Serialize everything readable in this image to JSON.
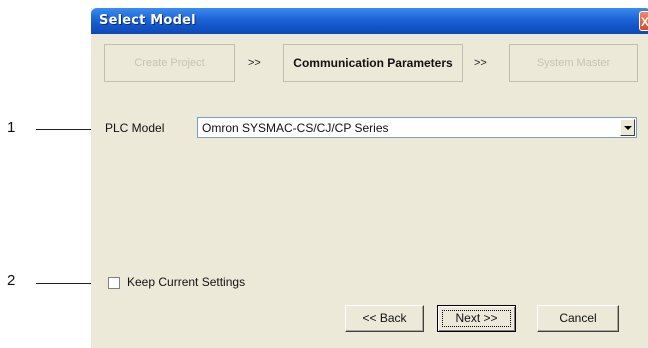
{
  "callouts": [
    {
      "number": "1",
      "target": "PLC Model"
    },
    {
      "number": "2",
      "target": "Keep Current Settings"
    }
  ],
  "dialog": {
    "title": "Select Model",
    "close_glyph": "X"
  },
  "steps": {
    "items": [
      {
        "label": "Create Project",
        "state": "disabled"
      },
      {
        "label": "Communication Parameters",
        "state": "active"
      },
      {
        "label": "System Master",
        "state": "disabled"
      }
    ],
    "separator": ">>"
  },
  "plc_model": {
    "label": "PLC Model",
    "selected": "Omron SYSMAC-CS/CJ/CP Series"
  },
  "keep_settings": {
    "label": "Keep Current Settings",
    "checked": false
  },
  "buttons": {
    "back": "<< Back",
    "next": "Next >>",
    "cancel": "Cancel"
  },
  "colors": {
    "titlebar": "#1f66d9",
    "dialog_bg": "#ece9d8",
    "close_button": "#d94a24"
  }
}
